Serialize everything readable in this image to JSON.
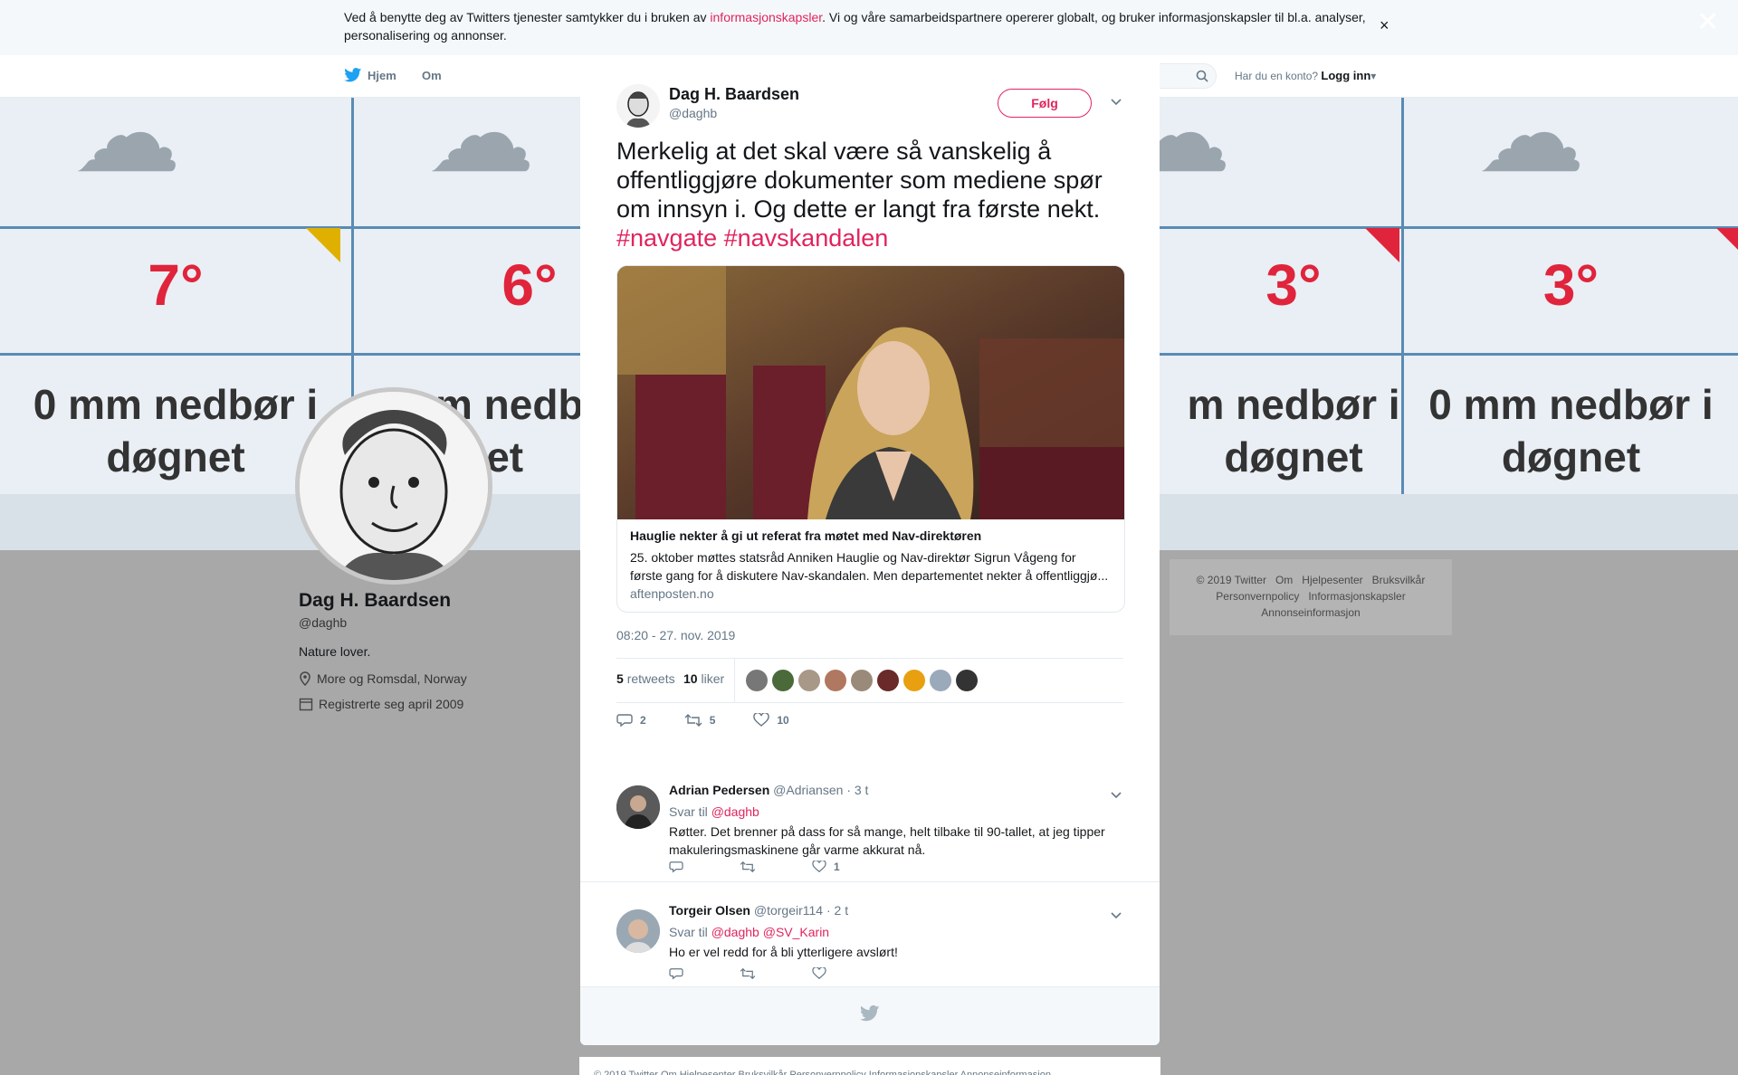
{
  "cookie": {
    "text_before": "Ved å benytte deg av Twitters tjenester samtykker du i bruken av ",
    "link": "informasjonskapsler",
    "text_after": ". Vi og våre samarbeidspartnere opererer globalt, og bruker informasjonskapsler til bl.a. analyser, personalisering og annonser."
  },
  "nav": {
    "home": "Hjem",
    "about": "Om",
    "account_q": "Har du en konto?",
    "login": "Logg inn"
  },
  "weather": {
    "temps": [
      "7°",
      "6°",
      "3°",
      "3°"
    ],
    "rain_line1": [
      "0 mm nedbør i",
      "m nedb",
      "m nedbør i",
      "0 mm nedbør i"
    ],
    "rain_line2": [
      "døgnet",
      "gnet",
      "døgnet",
      "døgnet"
    ]
  },
  "profile": {
    "name": "Dag H. Baardsen",
    "handle": "@daghb",
    "bio": "Nature lover.",
    "location": "More og Romsdal, Norway",
    "joined": "Registrerte seg april 2009"
  },
  "side_footer": {
    "line1": [
      "© 2019 Twitter",
      "Om",
      "Hjelpesenter",
      "Bruksvilkår"
    ],
    "line2": [
      "Personvernpolicy",
      "Informasjonskapsler"
    ],
    "line3": [
      "Annonseinformasjon"
    ]
  },
  "bottom_footer": "© 2019 Twitter   Om   Hjelpesenter   Bruksvilkår   Personvernpolicy   Informasjonskapsler   Annonseinformasjon",
  "tweet": {
    "name": "Dag H. Baardsen",
    "handle": "@daghb",
    "follow_label": "Følg",
    "text": "Merkelig at det skal være så vanskelig å offentliggjøre dokumenter som mediene spør om innsyn i. Og dette er langt fra første nekt.",
    "hashtags": [
      "#navgate",
      "#navskandalen"
    ],
    "card": {
      "title": "Hauglie nekter å gi ut referat fra møtet med Nav-direktøren",
      "description": "25. oktober møttes statsråd Anniken Hauglie og Nav-direktør Sigrun Vågeng for første gang for å diskutere Nav-skandalen. Men departementet nekter å offentliggjø...",
      "domain": "aftenposten.no"
    },
    "date": "08:20 - 27. nov. 2019",
    "retweets_count": "5",
    "retweets_label": "retweets",
    "likes_count": "10",
    "likes_label": "liker",
    "actions": {
      "replies": "2",
      "retweets": "5",
      "likes": "10"
    }
  },
  "replies": [
    {
      "name": "Adrian Pedersen",
      "handle": "@Adriansen",
      "time": "· 3 t",
      "reply_to_label": "Svar til",
      "mentions": [
        "@daghb"
      ],
      "text": "Røtter. Det brenner på dass for så mange, helt tilbake til 90-tallet, at jeg tipper makuleringsmaskinene går varme akkurat nå.",
      "likes": "1"
    },
    {
      "name": "Torgeir Olsen",
      "handle": "@torgeir114",
      "time": "· 2 t",
      "reply_to_label": "Svar til",
      "mentions": [
        "@daghb",
        "@SV_Karin"
      ],
      "text": "Ho er vel redd for å bli ytterligere avslørt!",
      "likes": ""
    }
  ],
  "colors": {
    "accent": "#e0245e",
    "twitter_blue": "#1da1f2",
    "secondary_text": "#657786"
  }
}
